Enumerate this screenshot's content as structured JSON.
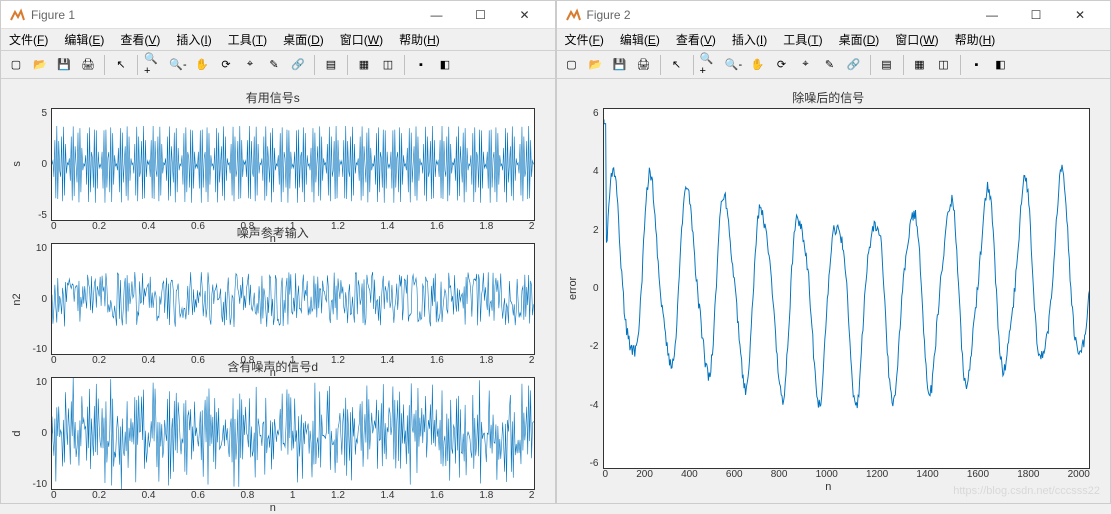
{
  "figures": [
    {
      "title": "Figure 1"
    },
    {
      "title": "Figure 2"
    }
  ],
  "menus": [
    {
      "label": "文件",
      "hotkey": "F"
    },
    {
      "label": "编辑",
      "hotkey": "E"
    },
    {
      "label": "查看",
      "hotkey": "V"
    },
    {
      "label": "插入",
      "hotkey": "I"
    },
    {
      "label": "工具",
      "hotkey": "T"
    },
    {
      "label": "桌面",
      "hotkey": "D"
    },
    {
      "label": "窗口",
      "hotkey": "W"
    },
    {
      "label": "帮助",
      "hotkey": "H"
    }
  ],
  "toolbar_icons": [
    "new-icon",
    "open-icon",
    "save-icon",
    "print-icon",
    "sep",
    "pointer-icon",
    "sep",
    "zoom-in-icon",
    "zoom-out-icon",
    "pan-icon",
    "rotate-icon",
    "datacursor-icon",
    "brush-icon",
    "link-icon",
    "sep",
    "colorbar-icon",
    "sep",
    "legend-icon",
    "plotedit-icon",
    "sep",
    "hide-icon",
    "dock-icon"
  ],
  "fig1": {
    "subplots": [
      {
        "title": "有用信号s",
        "ylabel": "s",
        "xlabel": "n",
        "yticks": [
          "5",
          "0",
          "-5"
        ],
        "xticks": [
          "0",
          "0.2",
          "0.4",
          "0.6",
          "0.8",
          "1",
          "1.2",
          "1.4",
          "1.6",
          "1.8",
          "2"
        ],
        "pattern": "s"
      },
      {
        "title": "噪声参考输入",
        "ylabel": "n2",
        "xlabel": "n",
        "yticks": [
          "10",
          "0",
          "-10"
        ],
        "xticks": [
          "0",
          "0.2",
          "0.4",
          "0.6",
          "0.8",
          "1",
          "1.2",
          "1.4",
          "1.6",
          "1.8",
          "2"
        ],
        "pattern": "noise"
      },
      {
        "title": "含有噪声的信号d",
        "ylabel": "d",
        "xlabel": "n",
        "yticks": [
          "10",
          "0",
          "-10"
        ],
        "xticks": [
          "0",
          "0.2",
          "0.4",
          "0.6",
          "0.8",
          "1",
          "1.2",
          "1.4",
          "1.6",
          "1.8",
          "2"
        ],
        "pattern": "noisy"
      }
    ]
  },
  "fig2": {
    "title": "除噪后的信号",
    "ylabel": "error",
    "xlabel": "n",
    "yticks": [
      "6",
      "4",
      "2",
      "0",
      "-2",
      "-4",
      "-6"
    ],
    "xticks": [
      "0",
      "200",
      "400",
      "600",
      "800",
      "1000",
      "1200",
      "1400",
      "1600",
      "1800",
      "2000"
    ]
  },
  "chart_data": [
    {
      "type": "line",
      "title": "有用信号s",
      "xlabel": "n",
      "ylabel": "s",
      "xlim": [
        0,
        2
      ],
      "ylim": [
        -5,
        5
      ],
      "description": "amplitude-modulated carrier; envelope oscillates ~30 lobes across x=0..2; y in ±5",
      "series": [
        {
          "name": "s",
          "x_range": [
            0,
            2
          ],
          "approx_y_range": [
            -5,
            5
          ]
        }
      ]
    },
    {
      "type": "line",
      "title": "噪声参考输入",
      "xlabel": "n",
      "ylabel": "n2",
      "xlim": [
        0,
        2
      ],
      "ylim": [
        -10,
        10
      ],
      "description": "broadband noise within roughly ±5",
      "series": [
        {
          "name": "n2",
          "x_range": [
            0,
            2
          ],
          "approx_y_range": [
            -5,
            5
          ]
        }
      ]
    },
    {
      "type": "line",
      "title": "含有噪声的信号d",
      "xlabel": "n",
      "ylabel": "d",
      "xlim": [
        0,
        2
      ],
      "ylim": [
        -10,
        10
      ],
      "description": "sum of s and noise; y roughly within ±8",
      "series": [
        {
          "name": "d",
          "x_range": [
            0,
            2
          ],
          "approx_y_range": [
            -8,
            8
          ]
        }
      ]
    },
    {
      "type": "line",
      "title": "除噪后的信号",
      "xlabel": "n",
      "ylabel": "error",
      "xlim": [
        0,
        2000
      ],
      "ylim": [
        -6,
        6
      ],
      "description": "recovered signal after adaptive noise cancellation; initial spike ~6 then beats ±4.5",
      "series": [
        {
          "name": "error",
          "x_range": [
            0,
            2000
          ],
          "approx_y_range": [
            -5,
            6
          ]
        }
      ]
    }
  ],
  "watermark": "https://blog.csdn.net/cccsss22"
}
